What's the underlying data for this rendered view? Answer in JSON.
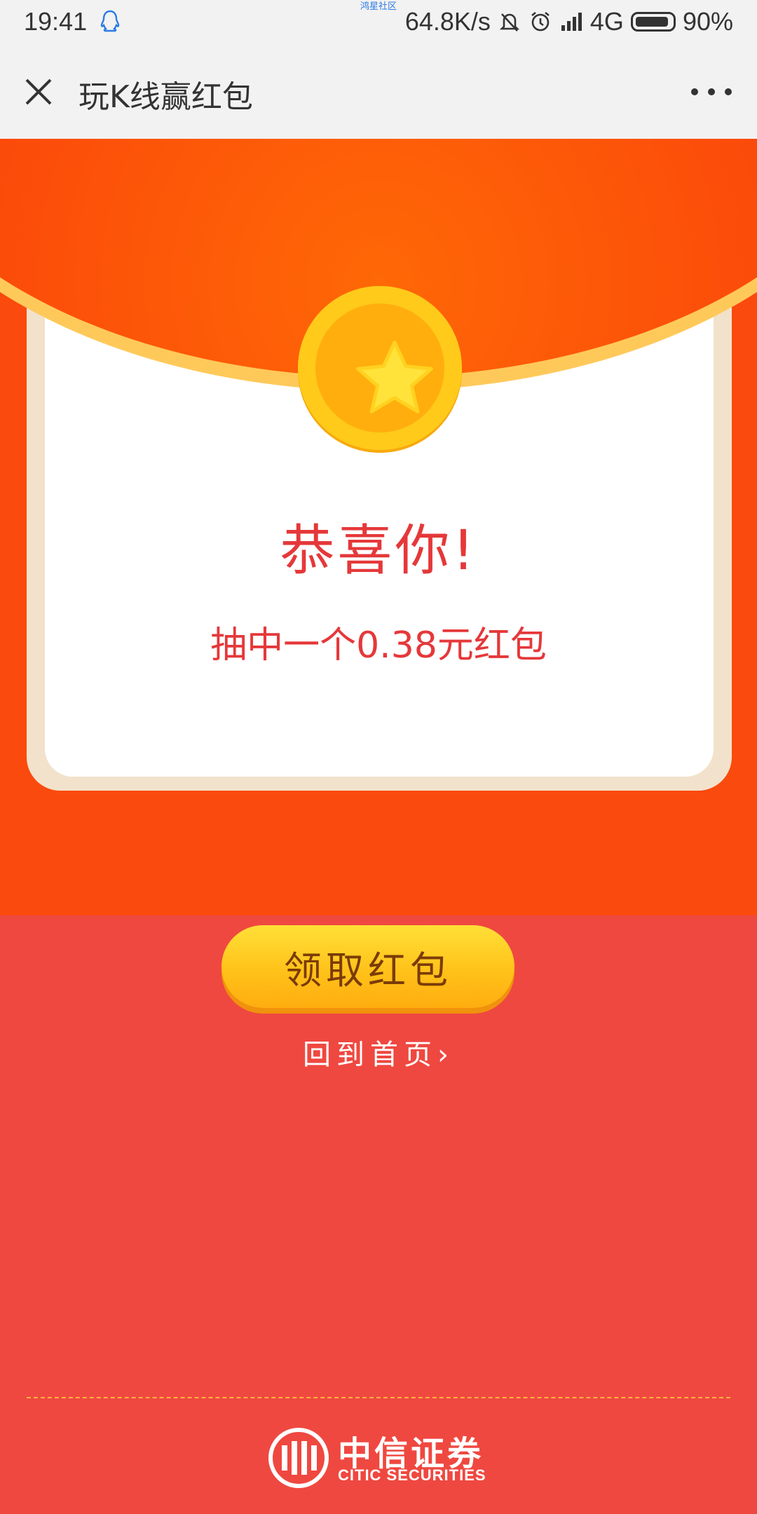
{
  "status_bar": {
    "time": "19:41",
    "network_speed": "64.8K/s",
    "network_type": "4G",
    "battery": "90%",
    "tiny_label": "鸿星社区"
  },
  "title_bar": {
    "title": "玩K线赢红包"
  },
  "card": {
    "congrats": "恭喜你!",
    "prize_text": "抽中一个0.38元红包"
  },
  "actions": {
    "claim_label": "领取红包",
    "home_link": "回到首页"
  },
  "footer": {
    "brand_cn": "中信证券",
    "brand_en": "CITIC SECURITIES"
  },
  "colors": {
    "accent_red": "#e5383a",
    "page_bg": "#ef4840",
    "button_yellow": "#ffc21a"
  }
}
